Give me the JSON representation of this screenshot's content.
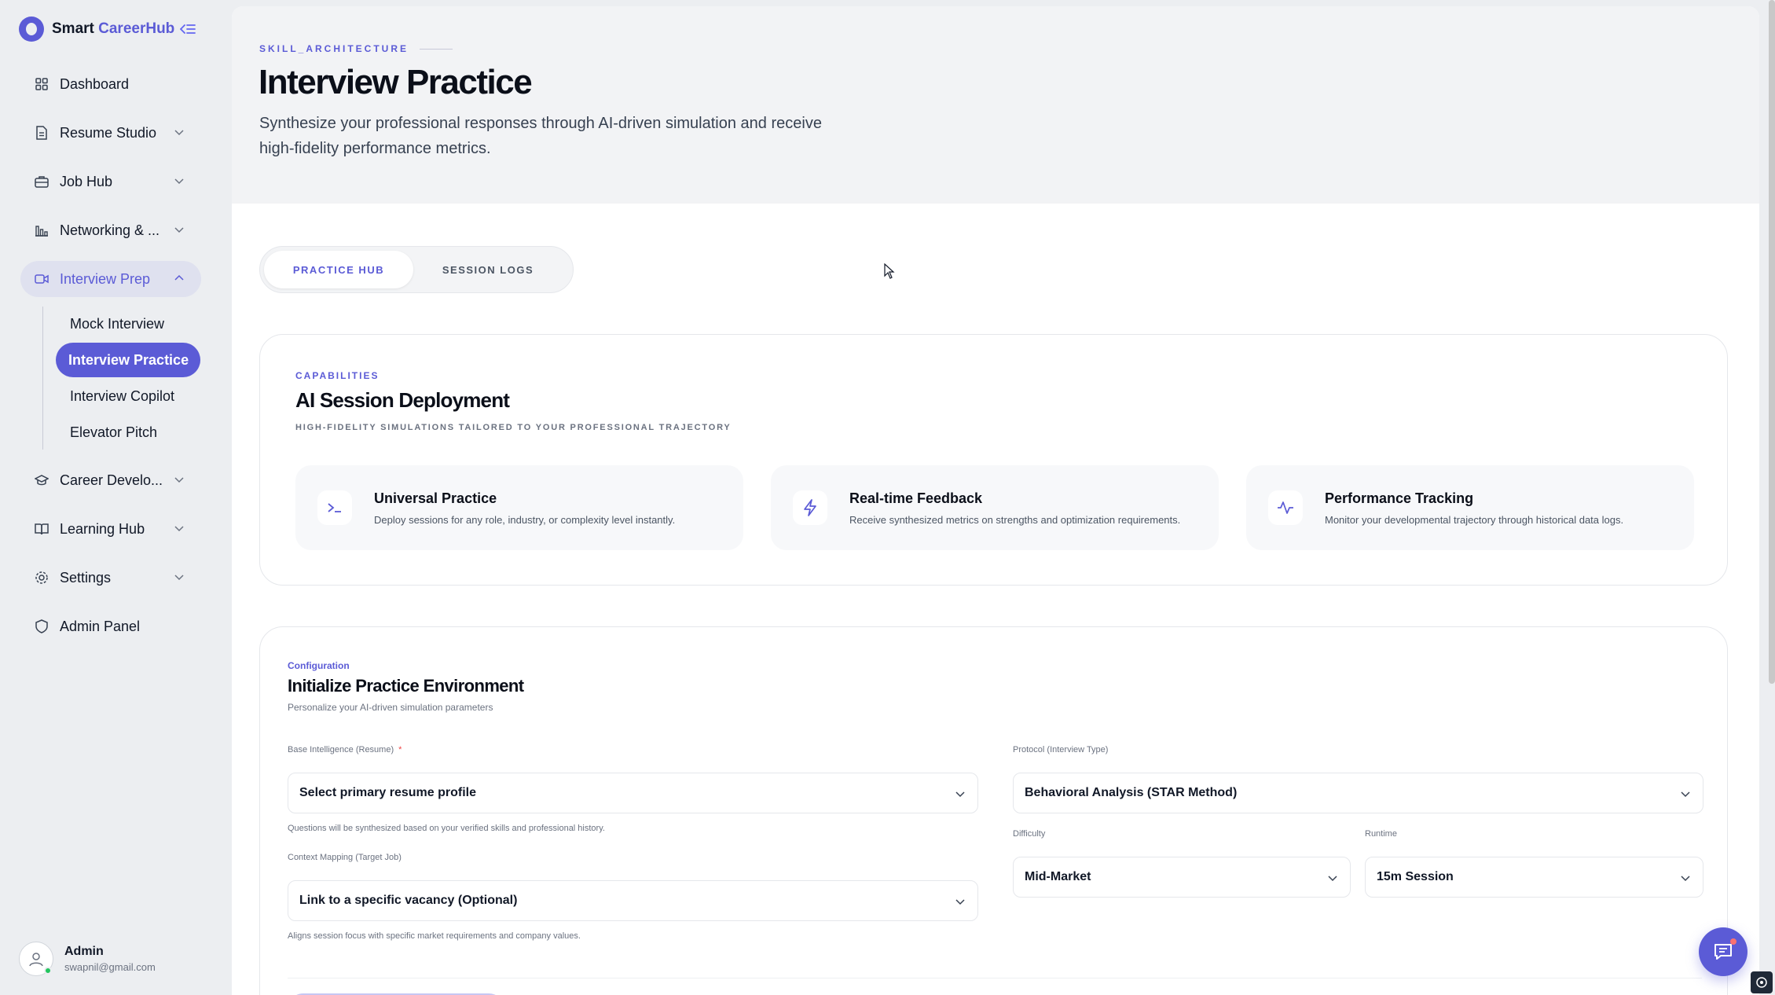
{
  "brand": {
    "name_part1": "Smart ",
    "name_part2": "CareerHub"
  },
  "sidebar": {
    "items": [
      {
        "label": "Dashboard"
      },
      {
        "label": "Resume Studio"
      },
      {
        "label": "Job Hub"
      },
      {
        "label": "Networking & ..."
      },
      {
        "label": "Interview Prep"
      },
      {
        "label": "Career Develo..."
      },
      {
        "label": "Learning Hub"
      },
      {
        "label": "Settings"
      },
      {
        "label": "Admin Panel"
      }
    ],
    "subitems": [
      {
        "label": "Mock Interview"
      },
      {
        "label": "Interview Practice"
      },
      {
        "label": "Interview Copilot"
      },
      {
        "label": "Elevator Pitch"
      }
    ]
  },
  "user": {
    "name": "Admin",
    "email": "swapnil@gmail.com"
  },
  "header": {
    "eyebrow": "SKILL_ARCHITECTURE",
    "title": "Interview Practice",
    "description": "Synthesize your professional responses through AI-driven simulation and receive high-fidelity performance metrics."
  },
  "tabs": [
    {
      "label": "PRACTICE HUB"
    },
    {
      "label": "SESSION LOGS"
    }
  ],
  "capabilities": {
    "eyebrow": "CAPABILITIES",
    "title": "AI Session Deployment",
    "subtitle": "HIGH-FIDELITY SIMULATIONS TAILORED TO YOUR PROFESSIONAL TRAJECTORY",
    "features": [
      {
        "title": "Universal Practice",
        "desc": "Deploy sessions for any role, industry, or complexity level instantly.",
        "icon": "terminal-icon"
      },
      {
        "title": "Real-time Feedback",
        "desc": "Receive synthesized metrics on strengths and optimization requirements.",
        "icon": "lightning-icon"
      },
      {
        "title": "Performance Tracking",
        "desc": "Monitor your developmental trajectory through historical data logs.",
        "icon": "activity-icon"
      }
    ]
  },
  "config": {
    "eyebrow": "Configuration",
    "title": "Initialize Practice Environment",
    "subtitle": "Personalize your AI-driven simulation parameters",
    "resume": {
      "label": "Base Intelligence (Resume)",
      "required": "*",
      "value": "Select primary resume profile",
      "helper": "Questions will be synthesized based on your verified skills and professional history."
    },
    "job": {
      "label": "Context Mapping (Target Job)",
      "value": "Link to a specific vacancy (Optional)",
      "helper": "Aligns session focus with specific market requirements and company values."
    },
    "protocol": {
      "label": "Protocol (Interview Type)",
      "value": "Behavioral Analysis (STAR Method)"
    },
    "difficulty": {
      "label": "Difficulty",
      "value": "Mid-Market"
    },
    "runtime": {
      "label": "Runtime",
      "value": "15m Session"
    }
  },
  "colors": {
    "accent": "#5b5bd6",
    "sidebar_bg": "#eceef1",
    "online": "#22c55e"
  }
}
